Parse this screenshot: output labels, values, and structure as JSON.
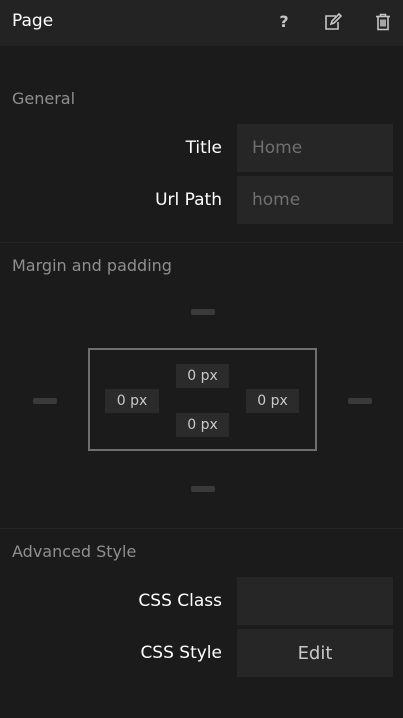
{
  "header": {
    "title": "Page",
    "icons": {
      "help": "question-mark-icon",
      "edit": "edit-icon",
      "delete": "trash-icon"
    }
  },
  "general": {
    "section_title": "General",
    "title_label": "Title",
    "title_placeholder": "Home",
    "url_label": "Url Path",
    "url_placeholder": "home"
  },
  "spacing": {
    "section_title": "Margin and padding",
    "padding_top": "0 px",
    "padding_left": "0 px",
    "padding_right": "0 px",
    "padding_bottom": "0 px"
  },
  "advanced": {
    "section_title": "Advanced Style",
    "css_class_label": "CSS Class",
    "css_class_value": "",
    "css_style_label": "CSS Style",
    "css_style_button": "Edit"
  },
  "colors": {
    "background": "#1b1b1b",
    "header": "#232323",
    "field": "#262626",
    "section_title": "#8f8f8f"
  }
}
